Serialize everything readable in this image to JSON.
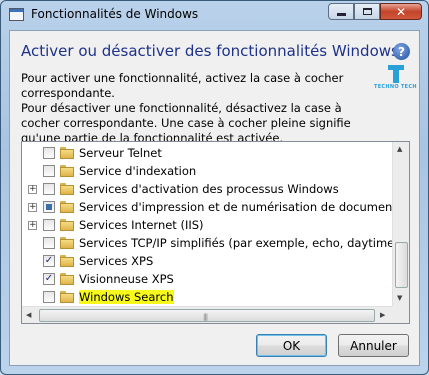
{
  "window": {
    "title": "Fonctionnalités de Windows"
  },
  "caption_buttons": {
    "minimize_icon": "minimize-icon",
    "maximize_icon": "maximize-icon",
    "close_label": "✕"
  },
  "heading": "Activer ou désactiver des fonctionnalités Windows",
  "help": {
    "label": "?"
  },
  "watermark": {
    "text": "TECHNO TECH"
  },
  "description": [
    "Pour activer une fonctionnalité, activez la case à cocher correspondante.",
    "Pour désactiver une fonctionnalité, désactivez la case à cocher correspondante. Une case à cocher pleine signifie qu'une partie de la fonctionnalité est activée."
  ],
  "features": [
    {
      "label": "Serveur Telnet",
      "state": "unchecked",
      "expandable": false
    },
    {
      "label": "Service d'indexation",
      "state": "unchecked",
      "expandable": false
    },
    {
      "label": "Services d'activation des processus Windows",
      "state": "unchecked",
      "expandable": true
    },
    {
      "label": "Services d'impression et de numérisation de document",
      "state": "partial",
      "expandable": true
    },
    {
      "label": "Services Internet (IIS)",
      "state": "unchecked",
      "expandable": true
    },
    {
      "label": "Services TCP/IP simplifiés (par exemple, echo, daytime, etc.)",
      "state": "unchecked",
      "expandable": false
    },
    {
      "label": "Services XPS",
      "state": "checked",
      "expandable": false
    },
    {
      "label": "Visionneuse XPS",
      "state": "checked",
      "expandable": false
    },
    {
      "label": "Windows Search",
      "state": "unchecked",
      "expandable": false,
      "highlighted": true
    }
  ],
  "highlight_color": "#f7f91c",
  "buttons": {
    "ok": "OK",
    "cancel": "Annuler"
  }
}
